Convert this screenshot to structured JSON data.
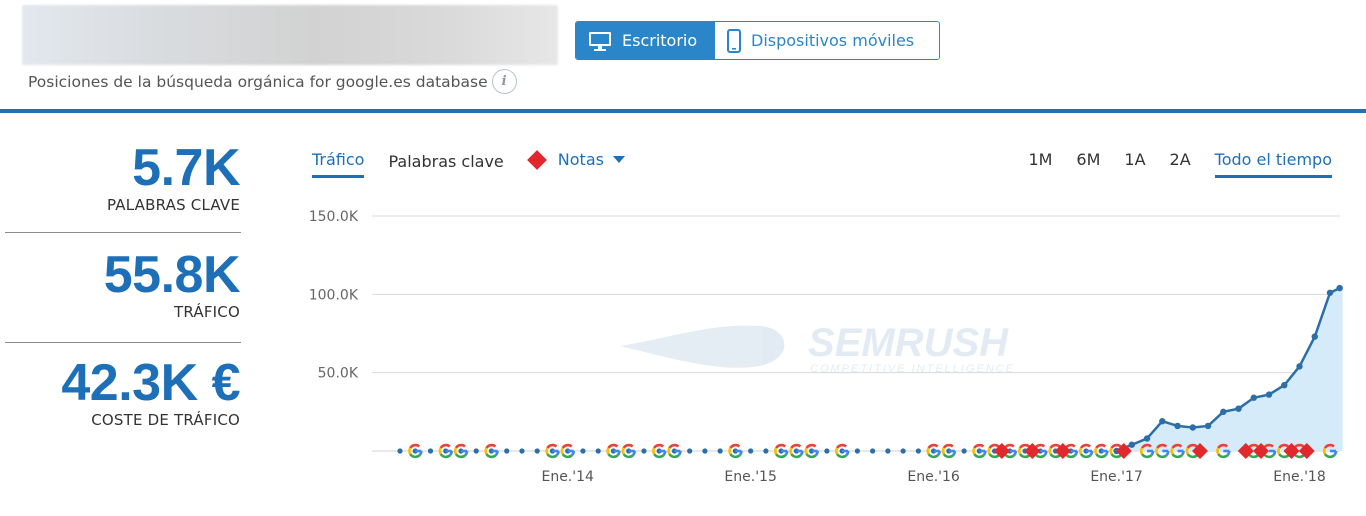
{
  "header": {
    "subtitle": "Posiciones de la búsqueda orgánica for google.es database",
    "info_glyph": "i"
  },
  "device_toggle": {
    "desktop_label": "Escritorio",
    "mobile_label": "Dispositivos móviles"
  },
  "stats": [
    {
      "value": "5.7K",
      "label": "PALABRAS CLAVE"
    },
    {
      "value": "55.8K",
      "label": "TRÁFICO"
    },
    {
      "value": "42.3K €",
      "label": "COSTE DE TRÁFICO"
    }
  ],
  "chart_tabs": {
    "traffic": "Tráfico",
    "keywords": "Palabras clave",
    "notes": "Notas"
  },
  "range_tabs": [
    "1M",
    "6M",
    "1A",
    "2A",
    "Todo el tiempo"
  ],
  "colors": {
    "accent": "#1d6fb8",
    "line": "#2b6ea8",
    "area": "#d6ebfa",
    "note_marker": "#e0282d"
  },
  "chart_data": {
    "type": "area",
    "y_ticks": [
      "150.0K",
      "100.0K",
      "50.0K"
    ],
    "y_tick_values": [
      150000,
      100000,
      50000
    ],
    "ylim": [
      0,
      150000
    ],
    "x_ticks": [
      {
        "label": "Ene.'14",
        "x": "2014-01"
      },
      {
        "label": "Ene.'15",
        "x": "2015-01"
      },
      {
        "label": "Ene.'16",
        "x": "2016-01"
      },
      {
        "label": "Ene.'17",
        "x": "2017-01"
      },
      {
        "label": "Ene.'18",
        "x": "2018-01"
      }
    ],
    "x_range": [
      "2013-02",
      "2018-03"
    ],
    "grid": true,
    "watermark": {
      "brand": "SEMRUSH",
      "tagline": "COMPETITIVE INTELLIGENCE"
    },
    "series": [
      {
        "values": [
          {
            "x": "2017-01",
            "y": 0
          },
          {
            "x": "2017-02",
            "y": 4000
          },
          {
            "x": "2017-03",
            "y": 8000
          },
          {
            "x": "2017-04",
            "y": 19000
          },
          {
            "x": "2017-05",
            "y": 16000
          },
          {
            "x": "2017-06",
            "y": 15000
          },
          {
            "x": "2017-07",
            "y": 16000
          },
          {
            "x": "2017-08",
            "y": 25000
          },
          {
            "x": "2017-09",
            "y": 27000
          },
          {
            "x": "2017-10",
            "y": 34000
          },
          {
            "x": "2017-11",
            "y": 36000
          },
          {
            "x": "2017-12",
            "y": 42000
          },
          {
            "x": "2018-01",
            "y": 54000
          },
          {
            "x": "2018-02",
            "y": 73000
          },
          {
            "x": "2018-03",
            "y": 101000
          },
          {
            "x": "2018-03-20",
            "y": 104000
          }
        ]
      }
    ],
    "google_update_months": [
      "2013-03",
      "2013-05",
      "2013-06",
      "2013-08",
      "2013-12",
      "2014-01",
      "2014-04",
      "2014-05",
      "2014-07",
      "2014-08",
      "2014-12",
      "2015-03",
      "2015-04",
      "2015-05",
      "2015-07",
      "2016-01",
      "2016-02",
      "2016-04",
      "2016-05",
      "2016-06",
      "2016-07",
      "2016-08",
      "2016-09",
      "2016-10",
      "2016-11",
      "2016-12",
      "2017-01",
      "2017-03",
      "2017-04",
      "2017-05",
      "2017-06",
      "2017-08",
      "2017-10",
      "2017-11",
      "2017-12",
      "2018-01",
      "2018-03"
    ],
    "note_months": [
      "2016-06",
      "2016-08",
      "2016-10",
      "2017-02",
      "2017-07",
      "2017-10",
      "2017-11",
      "2018-01",
      "2018-02"
    ]
  }
}
